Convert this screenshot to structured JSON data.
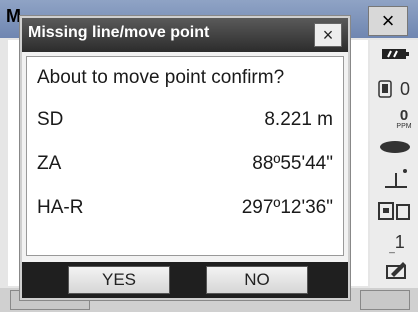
{
  "background": {
    "title_fragment": "M",
    "close_symbol": "×"
  },
  "side_panel": {
    "icons": [
      {
        "name": "battery-icon",
        "text": ""
      },
      {
        "name": "memory-card-icon",
        "text": "0"
      },
      {
        "name": "ppm-icon",
        "text": "0",
        "sub": "PPM"
      },
      {
        "name": "target-prism-icon",
        "text": ""
      },
      {
        "name": "tilt-icon",
        "text": ""
      },
      {
        "name": "instrument-icon",
        "text": ""
      },
      {
        "name": "input-mode-icon",
        "text": "1"
      },
      {
        "name": "pen-icon",
        "text": ""
      }
    ]
  },
  "dialog": {
    "title": "Missing line/move point",
    "close_symbol": "×",
    "prompt": "About to move point confirm?",
    "rows": [
      {
        "label": "SD",
        "value": "8.221 m"
      },
      {
        "label": "ZA",
        "value": "88º55'44\""
      },
      {
        "label": "HA-R",
        "value": "297º12'36\""
      }
    ],
    "buttons": {
      "yes": "YES",
      "no": "NO"
    }
  }
}
